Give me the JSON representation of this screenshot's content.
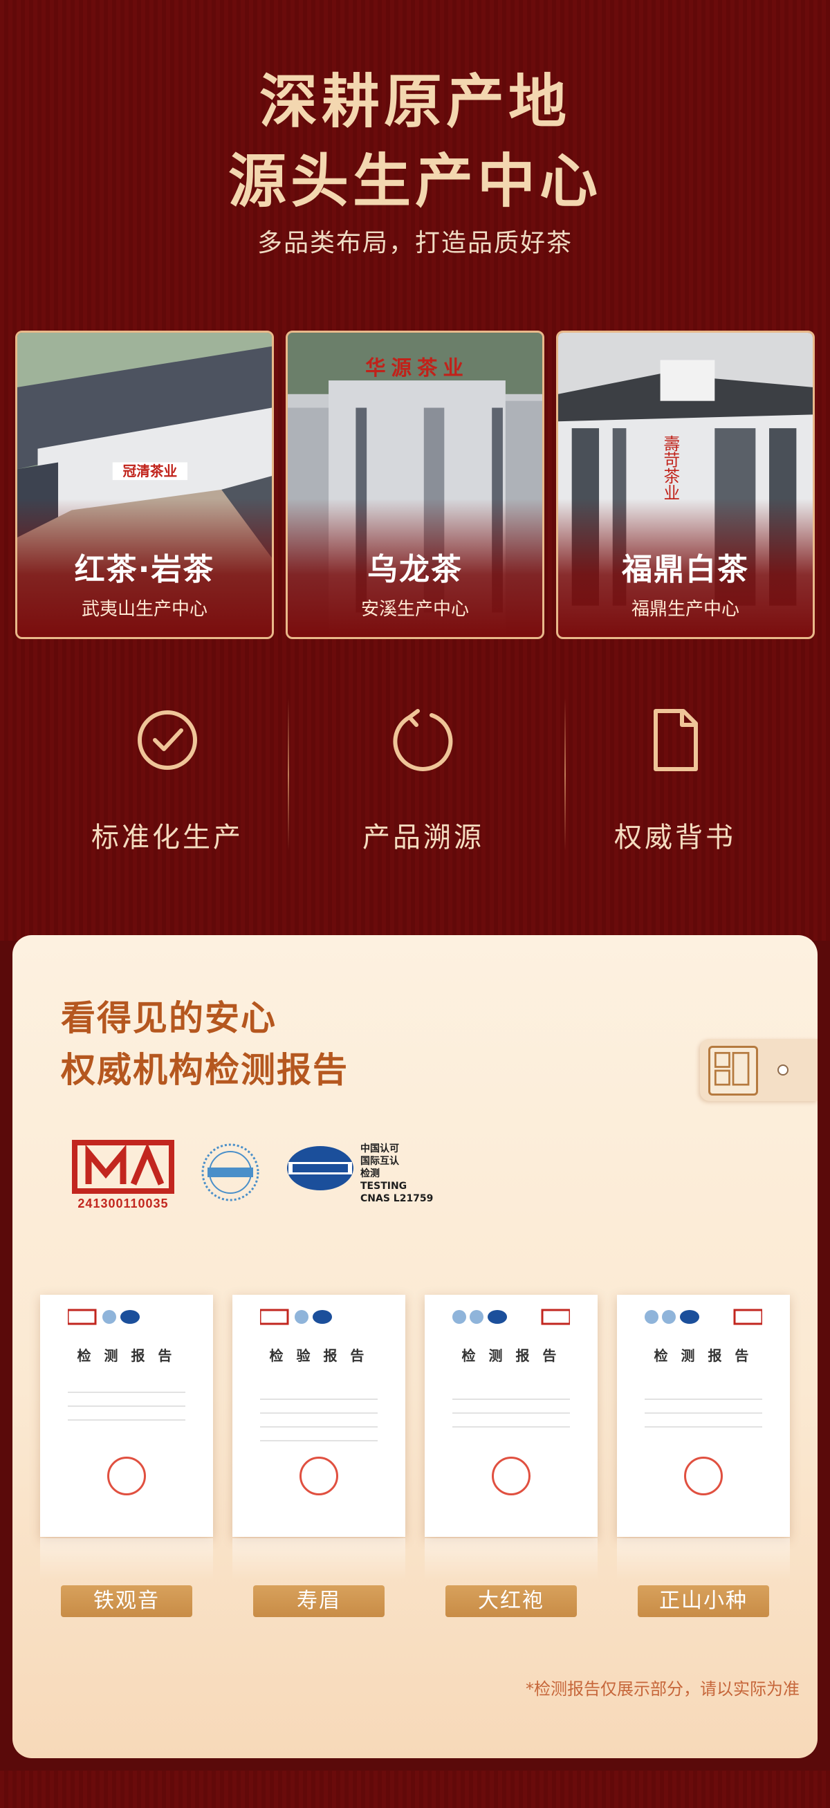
{
  "header": {
    "title_line1": "深耕原产地",
    "title_line2": "源头生产中心",
    "subtitle": "多品类布局，打造品质好茶"
  },
  "centers": [
    {
      "name": "红茶·岩茶",
      "location": "武夷山生产中心",
      "sign": "冠清茶业"
    },
    {
      "name": "乌龙茶",
      "location": "安溪生产中心",
      "sign": "华源茶业"
    },
    {
      "name": "福鼎白茶",
      "location": "福鼎生产中心",
      "sign": "壽苛茶业"
    }
  ],
  "features": [
    {
      "label": "标准化生产",
      "icon": "check-circle-icon"
    },
    {
      "label": "产品溯源",
      "icon": "refresh-icon"
    },
    {
      "label": "权威背书",
      "icon": "document-icon"
    }
  ],
  "assurance": {
    "title_line1": "看得见的安心",
    "title_line2": "权威机构检测报告",
    "ma_number": "241300110035",
    "cnas_text": [
      "中国认可",
      "国际互认",
      "检测",
      "TESTING",
      "CNAS L21759"
    ],
    "reports": [
      {
        "title": "检 测 报 告",
        "tag": "铁观音"
      },
      {
        "title": "检 验 报 告",
        "tag": "寿眉"
      },
      {
        "title": "检 测 报 告",
        "tag": "大红袍"
      },
      {
        "title": "检 测 报 告",
        "tag": "正山小种"
      }
    ],
    "note": "*检测报告仅展示部分，请以实际为准"
  },
  "colors": {
    "deep_red": "#6a0b0b",
    "gold": "#f3d7b0",
    "orange_title": "#b5571f",
    "tag_gold": "#d8a15c"
  }
}
